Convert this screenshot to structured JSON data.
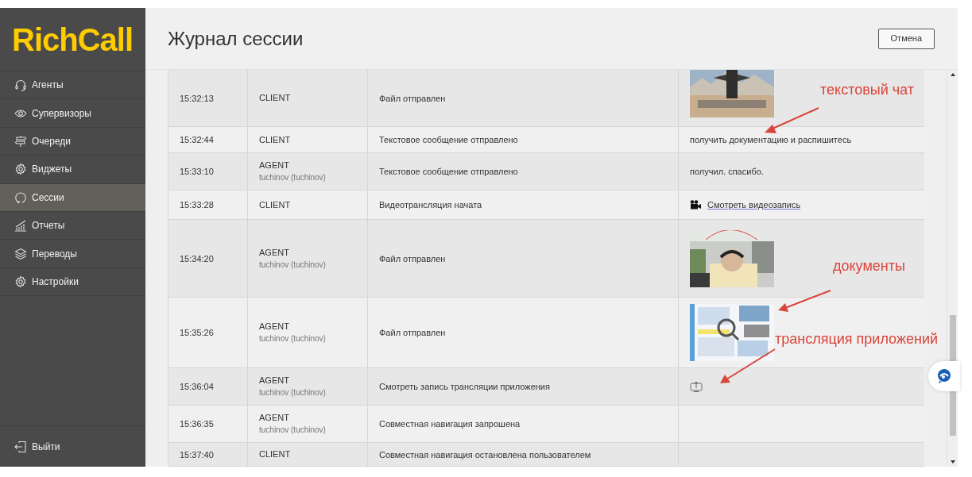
{
  "logo": "RichCall",
  "nav": [
    {
      "label": "Агенты",
      "selected": false
    },
    {
      "label": "Супервизоры",
      "selected": false
    },
    {
      "label": "Очереди",
      "selected": false
    },
    {
      "label": "Виджеты",
      "selected": false
    },
    {
      "label": "Сессии",
      "selected": true
    },
    {
      "label": "Отчеты",
      "selected": false
    },
    {
      "label": "Переводы",
      "selected": false
    },
    {
      "label": "Настройки",
      "selected": false
    }
  ],
  "logout": "Выйти",
  "title": "Журнал сессии",
  "cancel_button": "Отмена",
  "rows": [
    {
      "time": "15:32:13",
      "role": "CLIENT",
      "event": "Файл отправлен"
    },
    {
      "time": "15:32:44",
      "role": "CLIENT",
      "event": "Текстовое сообщение отправлено",
      "content": {
        "kind": "text",
        "text": "получить документацию и распишитесь"
      }
    },
    {
      "time": "15:33:10",
      "role": "AGENT",
      "user": "tuchinov (tuchinov)",
      "event": "Текстовое сообщение отправлено",
      "content": {
        "kind": "text",
        "text": "получил. спасибо."
      }
    },
    {
      "time": "15:33:28",
      "role": "CLIENT",
      "event": "Видеотрансляция начата",
      "content": {
        "kind": "video",
        "text": "Смотреть видеозапись"
      }
    },
    {
      "time": "15:34:20",
      "role": "AGENT",
      "user": "tuchinov (tuchinov)",
      "event": "Файл отправлен"
    },
    {
      "time": "15:35:26",
      "role": "AGENT",
      "user": "tuchinov (tuchinov)",
      "event": "Файл отправлен"
    },
    {
      "time": "15:36:04",
      "role": "AGENT",
      "user": "tuchinov (tuchinov)",
      "event": "Смотреть запись трансляции приложения",
      "content": {
        "kind": "screenshare"
      }
    },
    {
      "time": "15:36:35",
      "role": "AGENT",
      "user": "tuchinov (tuchinov)",
      "event": "Совместная навигация запрошена",
      "content": {
        "kind": "empty"
      }
    },
    {
      "time": "15:37:40",
      "role": "CLIENT",
      "event": "Совместная навигация остановлена пользователем",
      "content": {
        "kind": "empty"
      }
    }
  ],
  "annotations": [
    {
      "text": "текстовый чат"
    },
    {
      "text": "документы"
    },
    {
      "text": "трансляция приложений"
    }
  ]
}
